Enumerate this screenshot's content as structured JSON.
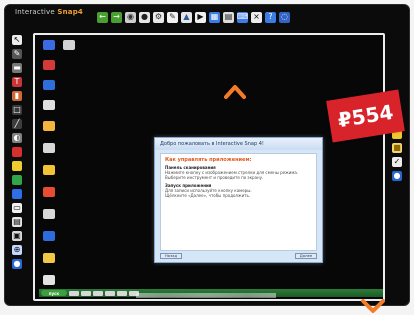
{
  "brand": {
    "name": "Interactive",
    "product": "Snap",
    "version": "4"
  },
  "top_toolbar": {
    "icons": [
      "arrow-left-icon",
      "arrow-right-icon",
      "camera-icon",
      "record-icon",
      "settings-icon",
      "pen-icon",
      "shapes-icon",
      "play-icon",
      "window-icon",
      "grid-icon",
      "keyboard-icon",
      "close-icon",
      "help-icon",
      "globe-icon"
    ]
  },
  "left_toolbar": {
    "icons": [
      "cursor-icon",
      "pen-icon",
      "highlighter-icon",
      "text-icon",
      "eraser-icon",
      "shape-icon",
      "line-icon",
      "palette-icon",
      "red-pen-icon",
      "yellow-pen-icon",
      "green-pen-icon",
      "blue-pen-icon",
      "monitor-icon",
      "file-icon",
      "window-icon",
      "zoom-icon",
      "circle-icon"
    ]
  },
  "right_toolbar": {
    "icons": [
      "blue-dot-icon",
      "yellow-icon",
      "folder-icon",
      "check-icon",
      "blue-orb-icon"
    ]
  },
  "dialog": {
    "title": "Добро пожаловать в Interactive Snap 4!",
    "header": "Как управлять приложением:",
    "section1_title": "Панель сканирования",
    "section2_title": "Запуск приложения",
    "lines": [
      "Нажмите кнопку с изображением стрелки для смены режима.",
      "Выберите инструмент и проведите по экрану.",
      "Для записи используйте кнопку камеры.",
      "Щёлкните «Далее», чтобы продолжить."
    ],
    "buttons": {
      "back": "Назад",
      "next": "Далее"
    }
  },
  "price": {
    "label": "₽554",
    "color": "#d9232b"
  },
  "taskbar": {
    "start_label": "пуск"
  }
}
